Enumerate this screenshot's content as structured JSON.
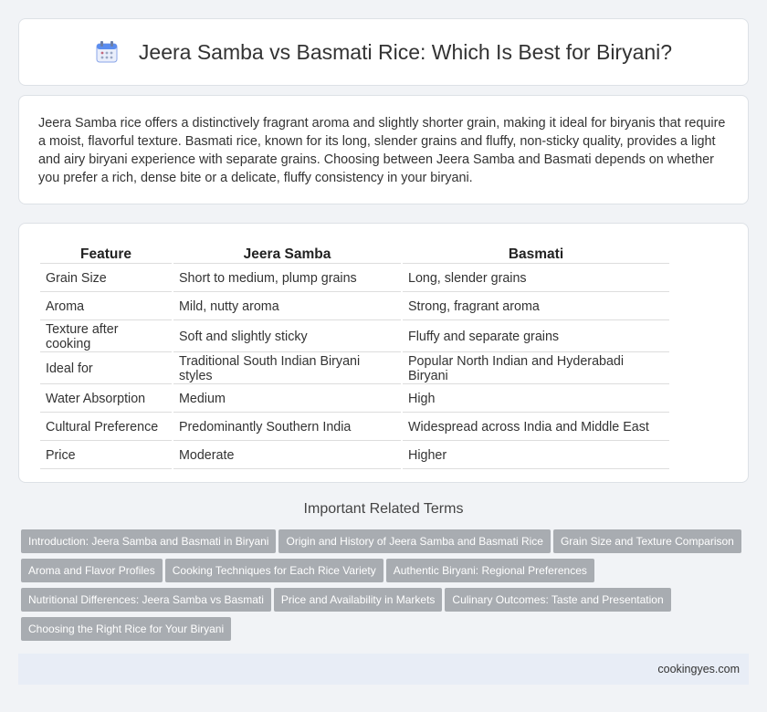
{
  "header": {
    "title": "Jeera Samba vs Basmati Rice: Which Is Best for Biryani?",
    "icon": "calendar-icon"
  },
  "intro": {
    "text": "Jeera Samba rice offers a distinctively fragrant aroma and slightly shorter grain, making it ideal for biryanis that require a moist, flavorful texture. Basmati rice, known for its long, slender grains and fluffy, non-sticky quality, provides a light and airy biryani experience with separate grains. Choosing between Jeera Samba and Basmati depends on whether you prefer a rich, dense bite or a delicate, fluffy consistency in your biryani."
  },
  "comparison": {
    "headers": [
      "Feature",
      "Jeera Samba",
      "Basmati"
    ],
    "rows": [
      [
        "Grain Size",
        "Short to medium, plump grains",
        "Long, slender grains"
      ],
      [
        "Aroma",
        "Mild, nutty aroma",
        "Strong, fragrant aroma"
      ],
      [
        "Texture after cooking",
        "Soft and slightly sticky",
        "Fluffy and separate grains"
      ],
      [
        "Ideal for",
        "Traditional South Indian Biryani styles",
        "Popular North Indian and Hyderabadi Biryani"
      ],
      [
        "Water Absorption",
        "Medium",
        "High"
      ],
      [
        "Cultural Preference",
        "Predominantly Southern India",
        "Widespread across India and Middle East"
      ],
      [
        "Price",
        "Moderate",
        "Higher"
      ]
    ]
  },
  "related": {
    "title": "Important Related Terms",
    "tags": [
      "Introduction: Jeera Samba and Basmati in Biryani",
      "Origin and History of Jeera Samba and Basmati Rice",
      "Grain Size and Texture Comparison",
      "Aroma and Flavor Profiles",
      "Cooking Techniques for Each Rice Variety",
      "Authentic Biryani: Regional Preferences",
      "Nutritional Differences: Jeera Samba vs Basmati",
      "Price and Availability in Markets",
      "Culinary Outcomes: Taste and Presentation",
      "Choosing the Right Rice for Your Biryani"
    ]
  },
  "footer": {
    "site": "cookingyes.com"
  },
  "colors": {
    "background": "#f1f3f6",
    "tag": "#a8acb1",
    "footer": "#e8edf6",
    "icon_accent": "#5b8def"
  }
}
